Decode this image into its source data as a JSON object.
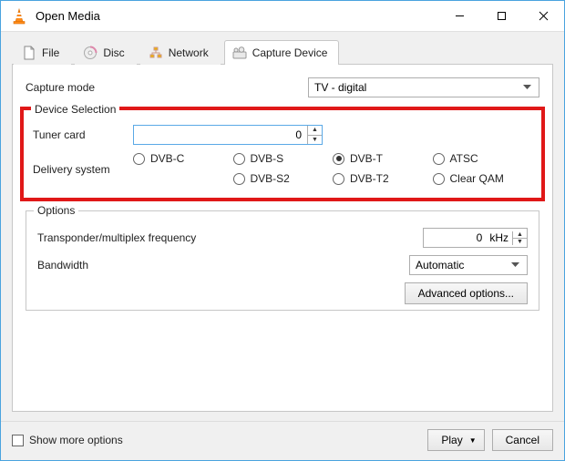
{
  "window": {
    "title": "Open Media"
  },
  "tabs": {
    "file": "File",
    "disc": "Disc",
    "network": "Network",
    "capture": "Capture Device"
  },
  "capture_mode": {
    "label": "Capture mode",
    "value": "TV - digital"
  },
  "device_selection": {
    "legend": "Device Selection",
    "tuner_label": "Tuner card",
    "tuner_value": "0",
    "delivery_label": "Delivery system",
    "radios": {
      "dvbc": "DVB-C",
      "dvbs": "DVB-S",
      "dvbt": "DVB-T",
      "atsc": "ATSC",
      "dvbs2": "DVB-S2",
      "dvbt2": "DVB-T2",
      "clearqam": "Clear QAM"
    },
    "selected": "dvbt"
  },
  "options": {
    "legend": "Options",
    "freq_label": "Transponder/multiplex frequency",
    "freq_value": "0",
    "freq_unit": "kHz",
    "bandwidth_label": "Bandwidth",
    "bandwidth_value": "Automatic",
    "advanced_btn": "Advanced options..."
  },
  "footer": {
    "show_more": "Show more options",
    "play": "Play",
    "cancel": "Cancel"
  }
}
